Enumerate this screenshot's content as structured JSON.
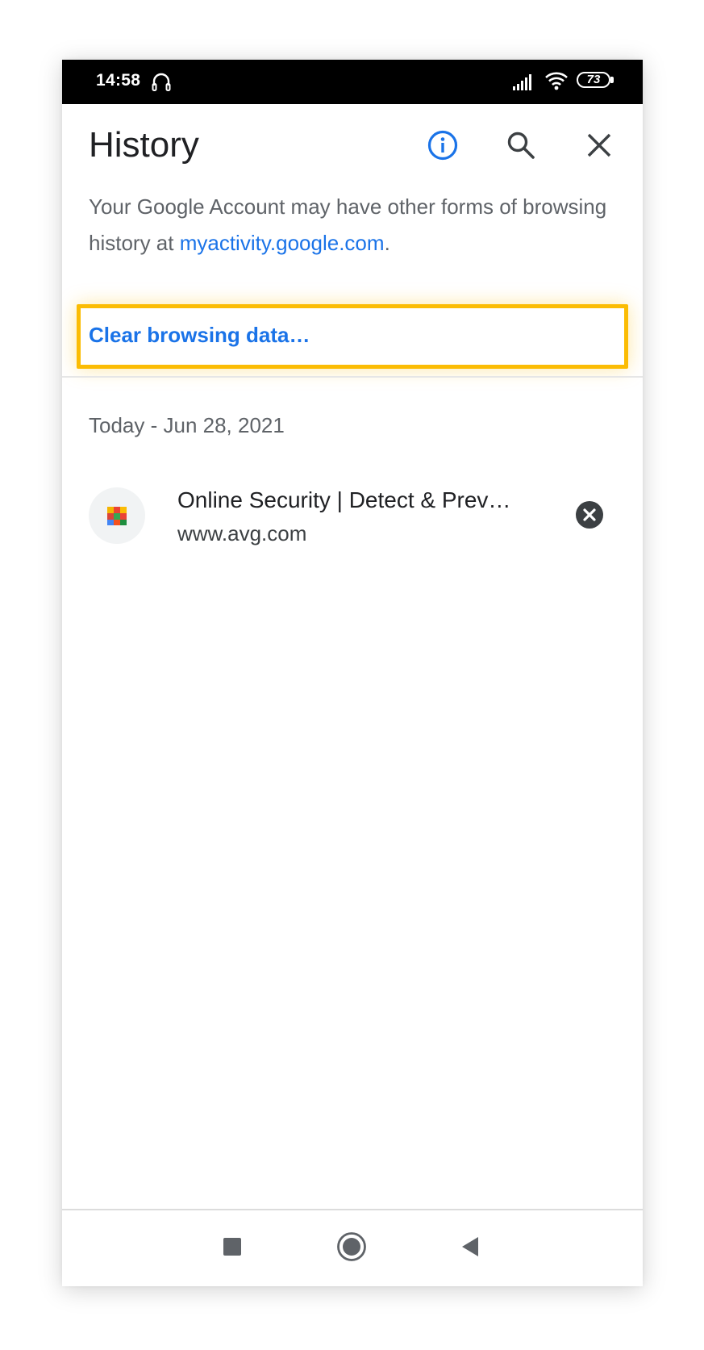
{
  "status_bar": {
    "time": "14:58",
    "battery": "73"
  },
  "header": {
    "title": "History",
    "icons": [
      "info-icon",
      "search-icon",
      "close-icon"
    ]
  },
  "account_note": {
    "text": "Your Google Account may have other forms of browsing history at ",
    "link": "myactivity.google.com",
    "suffix": "."
  },
  "clear_browsing": {
    "label": "Clear browsing data…"
  },
  "history": {
    "date_header": "Today - Jun 28, 2021",
    "items": [
      {
        "title": "Online Security | Detect & Prev…",
        "url": "www.avg.com",
        "favicon": "avg-favicon"
      }
    ]
  },
  "navbar": {
    "icons": [
      "recents-icon",
      "home-icon",
      "back-icon"
    ]
  },
  "colors": {
    "accent": "#1a73e8",
    "highlight": "#fbbc04",
    "text_primary": "#202124",
    "text_secondary": "#5f6368"
  }
}
